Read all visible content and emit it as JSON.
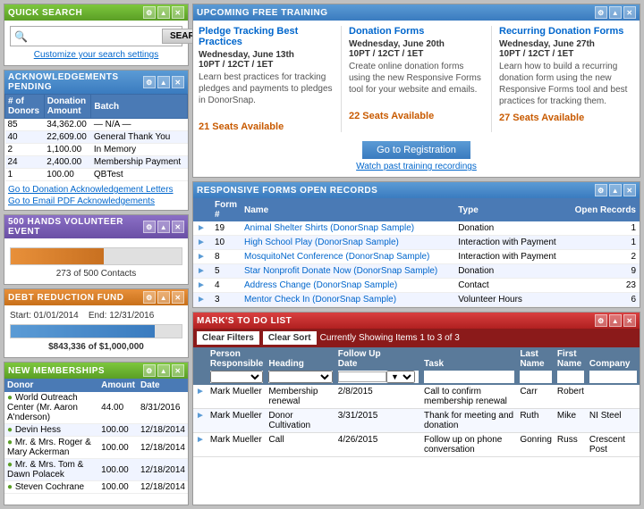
{
  "quickSearch": {
    "title": "Quick Search",
    "placeholder": "",
    "searchButtonLabel": "SEARCH",
    "customizeLink": "Customize your search settings"
  },
  "acknowledgements": {
    "title": "Acknowledgements Pending",
    "columns": [
      "# of Donors",
      "Donation Amount",
      "Batch"
    ],
    "rows": [
      {
        "donors": "85",
        "amount": "34,362.00",
        "batch": "— N/A —"
      },
      {
        "donors": "40",
        "amount": "22,609.00",
        "batch": "General Thank You"
      },
      {
        "donors": "2",
        "amount": "1,100.00",
        "batch": "In Memory"
      },
      {
        "donors": "24",
        "amount": "2,400.00",
        "batch": "Membership Payment"
      },
      {
        "donors": "1",
        "amount": "100.00",
        "batch": "QBTest"
      }
    ],
    "link1": "Go to Donation Acknowledgement Letters",
    "link2": "Go to Email PDF Acknowledgements"
  },
  "volunteerEvent": {
    "title": "500 Hands Volunteer Event",
    "progress": 54.6,
    "progressLabel": "273 of 500 Contacts"
  },
  "debtReduction": {
    "title": "Debt Reduction Fund",
    "startDate": "Start: 01/01/2014",
    "endDate": "End: 12/31/2016",
    "progress": 84.3,
    "amount": "$843,336 of $1,000,000"
  },
  "newMemberships": {
    "title": "New Memberships",
    "columns": [
      "Donor",
      "Amount",
      "Date"
    ],
    "rows": [
      {
        "donor": "World Outreach Center (Mr. Aaron A'nderson)",
        "amount": "44.00",
        "date": "8/31/2016",
        "dot": true
      },
      {
        "donor": "Devin Hess",
        "amount": "100.00",
        "date": "12/18/2014",
        "dot": true
      },
      {
        "donor": "Mr. & Mrs. Roger & Mary Ackerman",
        "amount": "100.00",
        "date": "12/18/2014",
        "dot": true
      },
      {
        "donor": "Mr. & Mrs. Tom & Dawn Polacek",
        "amount": "100.00",
        "date": "12/18/2014",
        "dot": true
      },
      {
        "donor": "Steven Cochrane",
        "amount": "100.00",
        "date": "12/18/2014",
        "dot": true
      }
    ]
  },
  "upcomingTraining": {
    "title": "Upcoming Free Training",
    "items": [
      {
        "title": "Pledge Tracking Best Practices",
        "date": "Wednesday, June 13th",
        "time": "10PT / 12CT / 1ET",
        "description": "Learn best practices for tracking pledges and payments to pledges in DonorSnap.",
        "seats": "21 Seats Available"
      },
      {
        "title": "Donation Forms",
        "date": "Wednesday, June 20th",
        "time": "10PT / 12CT / 1ET",
        "description": "Create online donation forms using the new Responsive Forms tool for your website and emails.",
        "seats": "22 Seats Available"
      },
      {
        "title": "Recurring Donation Forms",
        "date": "Wednesday, June 27th",
        "time": "10PT / 12CT / 1ET",
        "description": "Learn how to build a recurring donation form using the new Responsive Forms tool and best practices for tracking them.",
        "seats": "27 Seats Available"
      }
    ],
    "registrationBtn": "Go to Registration",
    "watchLink": "Watch past training recordings"
  },
  "responsiveForms": {
    "title": "Responsive Forms Open Records",
    "columns": [
      "Form #",
      "Name",
      "Type",
      "Open Records"
    ],
    "rows": [
      {
        "num": "19",
        "name": "Animal Shelter Shirts (DonorSnap Sample)",
        "type": "Donation",
        "records": "1"
      },
      {
        "num": "10",
        "name": "High School Play (DonorSnap Sample)",
        "type": "Interaction with Payment",
        "records": "1"
      },
      {
        "num": "8",
        "name": "MosquitoNet Conference (DonorSnap Sample)",
        "type": "Interaction with Payment",
        "records": "2"
      },
      {
        "num": "5",
        "name": "Star Nonprofit Donate Now (DonorSnap Sample)",
        "type": "Donation",
        "records": "9"
      },
      {
        "num": "4",
        "name": "Address Change (DonorSnap Sample)",
        "type": "Contact",
        "records": "23"
      },
      {
        "num": "3",
        "name": "Mentor Check In (DonorSnap Sample)",
        "type": "Volunteer Hours",
        "records": "6"
      }
    ]
  },
  "todoList": {
    "title": "Mark's To Do List",
    "clearFiltersBtn": "Clear Filters",
    "clearSortBtn": "Clear Sort",
    "showingText": "Currently Showing Items 1 to 3 of 3",
    "columns": [
      "Person Responsible",
      "Heading",
      "Follow Up Date",
      "Task",
      "Last Name",
      "First Name",
      "Company"
    ],
    "rows": [
      {
        "person": "Mark Mueller",
        "heading": "Membership renewal",
        "followUp": "2/8/2015",
        "task": "Call to confirm membership renewal",
        "lastName": "Carr",
        "firstName": "Robert",
        "company": ""
      },
      {
        "person": "Mark Mueller",
        "heading": "Donor Cultivation",
        "followUp": "3/31/2015",
        "task": "Thank for meeting and donation",
        "lastName": "Ruth",
        "firstName": "Mike",
        "company": "NI Steel"
      },
      {
        "person": "Mark Mueller",
        "heading": "Call",
        "followUp": "4/26/2015",
        "task": "Follow up on phone conversation",
        "lastName": "Gonring",
        "firstName": "Russ",
        "company": "Crescent Post"
      }
    ]
  }
}
